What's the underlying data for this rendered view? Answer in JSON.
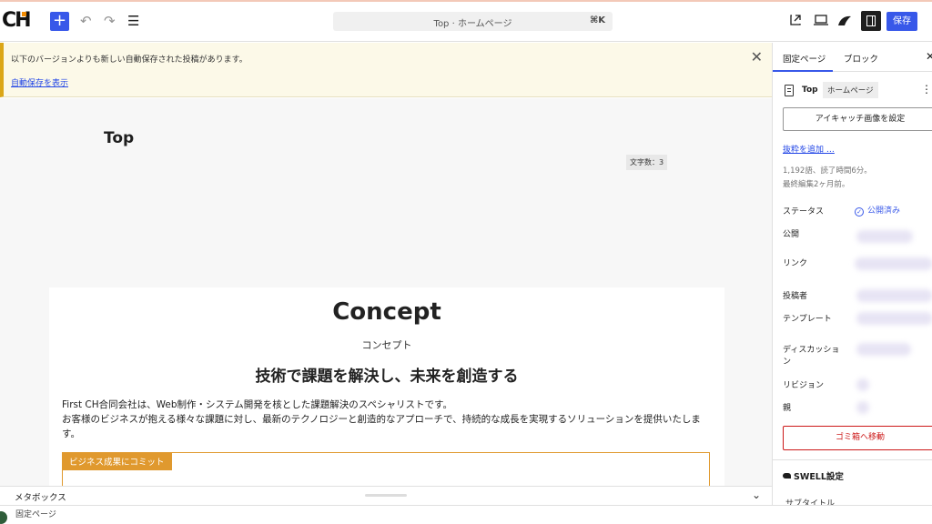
{
  "topbar": {
    "logo": "CH",
    "command_label": "Top · ホームページ",
    "command_shortcut": "⌘K",
    "save_label": "保存"
  },
  "notice": {
    "message": "以下のバージョンよりも新しい自動保存された投稿があります。",
    "link": "自動保存を表示"
  },
  "editor": {
    "title": "Top",
    "word_count": "文字数：3",
    "concept": "Concept",
    "concept_sub": "コンセプト",
    "concept_heading": "技術で課題を解決し、未来を創造する",
    "paragraph_line1": "First CH合同会社は、Web制作・システム開発を核とした課題解決のスペシャリストです。",
    "paragraph_line2": "お客様のビジネスが抱える様々な課題に対し、最新のテクノロジーと創造的なアプローチで、持続的な成長を実現するソリューションを提供いたします。",
    "box_label": "ビジネス成果にコミット"
  },
  "metabox": {
    "label": "メタボックス"
  },
  "footer": {
    "breadcrumb": "固定ページ"
  },
  "sidebar": {
    "tabs": [
      "固定ページ",
      "ブロック"
    ],
    "doc_title": "Top",
    "doc_tag": "ホームページ",
    "featured_image_button": "アイキャッチ画像を設定",
    "excerpt_link": "抜粋を追加 …",
    "stats_line1": "1,192語、読了時間6分。",
    "stats_line2": "最終編集2ヶ月前。",
    "rows": {
      "status": "ステータス",
      "status_value": "公開済み",
      "publish": "公開",
      "link": "リンク",
      "author": "投稿者",
      "template": "テンプレート",
      "discussion_1": "ディスカッショ",
      "discussion_2": "ン",
      "revisions": "リビジョン",
      "parent": "親"
    },
    "trash_button": "ゴミ箱へ移動",
    "swell_settings": "SWELL設定",
    "subtitle_cut": "サブタイトル"
  },
  "colors": {
    "accent": "#3858e9",
    "notice_border": "#dba617",
    "box_border": "#e0992e",
    "danger": "#cc1818"
  }
}
